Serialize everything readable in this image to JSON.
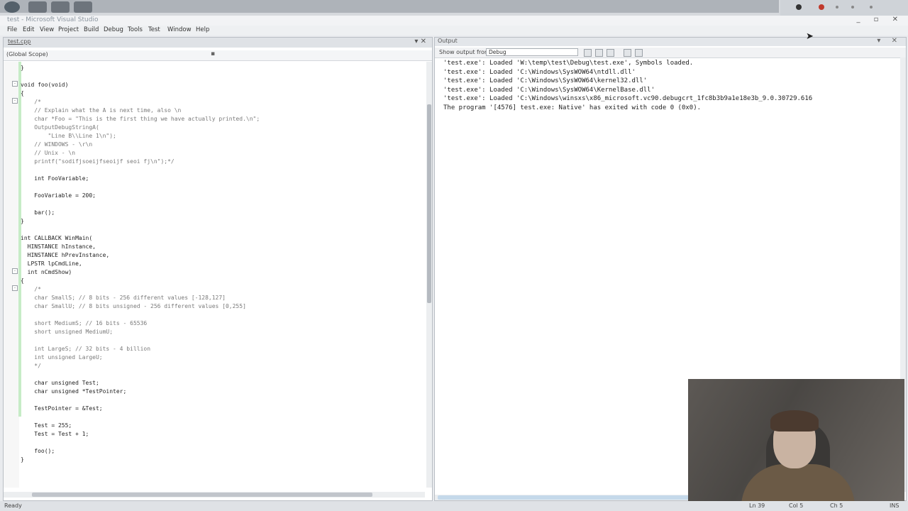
{
  "window": {
    "title": "test - Microsoft Visual Studio",
    "controls": "_ ▫ ✕"
  },
  "menu": [
    "File",
    "Edit",
    "View",
    "Project",
    "Build",
    "Debug",
    "Tools",
    "Test",
    "Window",
    "Help"
  ],
  "editor": {
    "tab_label": "test.cpp",
    "nav_scope": "(Global Scope)",
    "lines": [
      {
        "t": "}",
        "c": ""
      },
      {
        "t": "",
        "c": ""
      },
      {
        "t": "void foo(void)",
        "c": ""
      },
      {
        "t": "{",
        "c": ""
      },
      {
        "t": "    /*",
        "c": "c-comment"
      },
      {
        "t": "    // Explain what the A is next time, also \\n",
        "c": "c-comment"
      },
      {
        "t": "    char *Foo = \"This is the first thing we have actually printed.\\n\";",
        "c": "c-comment"
      },
      {
        "t": "    OutputDebugStringA(",
        "c": "c-comment"
      },
      {
        "t": "        \"Line B\\\\Line 1\\n\");",
        "c": "c-comment"
      },
      {
        "t": "    // WINDOWS - \\r\\n",
        "c": "c-comment"
      },
      {
        "t": "    // Unix - \\n",
        "c": "c-comment"
      },
      {
        "t": "    printf(\"sodifjsoeijfseoijf seoi fj\\n\");*/",
        "c": "c-comment"
      },
      {
        "t": "",
        "c": ""
      },
      {
        "t": "    int FooVariable;",
        "c": ""
      },
      {
        "t": "",
        "c": ""
      },
      {
        "t": "    FooVariable = 200;",
        "c": ""
      },
      {
        "t": "",
        "c": ""
      },
      {
        "t": "    bar();",
        "c": ""
      },
      {
        "t": "}",
        "c": ""
      },
      {
        "t": "",
        "c": ""
      },
      {
        "t": "int CALLBACK WinMain(",
        "c": ""
      },
      {
        "t": "  HINSTANCE hInstance,",
        "c": ""
      },
      {
        "t": "  HINSTANCE hPrevInstance,",
        "c": ""
      },
      {
        "t": "  LPSTR lpCmdLine,",
        "c": ""
      },
      {
        "t": "  int nCmdShow)",
        "c": ""
      },
      {
        "t": "{",
        "c": ""
      },
      {
        "t": "    /*",
        "c": "c-comment"
      },
      {
        "t": "    char SmallS; // 8 bits - 256 different values [-128,127]",
        "c": "c-comment"
      },
      {
        "t": "    char SmallU; // 8 bits unsigned - 256 different values [0,255]",
        "c": "c-comment"
      },
      {
        "t": "",
        "c": ""
      },
      {
        "t": "    short MediumS; // 16 bits - 65536",
        "c": "c-comment"
      },
      {
        "t": "    short unsigned MediumU;",
        "c": "c-comment"
      },
      {
        "t": "",
        "c": ""
      },
      {
        "t": "    int LargeS; // 32 bits - 4 billion",
        "c": "c-comment"
      },
      {
        "t": "    int unsigned LargeU;",
        "c": "c-comment"
      },
      {
        "t": "    */",
        "c": "c-comment"
      },
      {
        "t": "",
        "c": ""
      },
      {
        "t": "    char unsigned Test;",
        "c": ""
      },
      {
        "t": "    char unsigned *TestPointer;",
        "c": ""
      },
      {
        "t": "",
        "c": ""
      },
      {
        "t": "    TestPointer = &Test;",
        "c": ""
      },
      {
        "t": "",
        "c": ""
      },
      {
        "t": "    Test = 255;",
        "c": ""
      },
      {
        "t": "    Test = Test + 1;",
        "c": ""
      },
      {
        "t": "",
        "c": ""
      },
      {
        "t": "    foo();",
        "c": ""
      },
      {
        "t": "}",
        "c": ""
      }
    ]
  },
  "output": {
    "title": "Output",
    "controls": "▾ ✕",
    "source_label": "Show output from:",
    "source_value": "Debug",
    "lines": [
      "'test.exe': Loaded 'W:\\temp\\test\\Debug\\test.exe', Symbols loaded.",
      "'test.exe': Loaded 'C:\\Windows\\SysWOW64\\ntdll.dll'",
      "'test.exe': Loaded 'C:\\Windows\\SysWOW64\\kernel32.dll'",
      "'test.exe': Loaded 'C:\\Windows\\SysWOW64\\KernelBase.dll'",
      "'test.exe': Loaded 'C:\\Windows\\winsxs\\x86_microsoft.vc90.debugcrt_1fc8b3b9a1e18e3b_9.0.30729.616",
      "The program '[4576] test.exe: Native' has exited with code 0 (0x0)."
    ]
  },
  "status": {
    "ready": "Ready",
    "ln": "Ln 39",
    "col": "Col 5",
    "ch": "Ch 5",
    "mode": "INS"
  }
}
